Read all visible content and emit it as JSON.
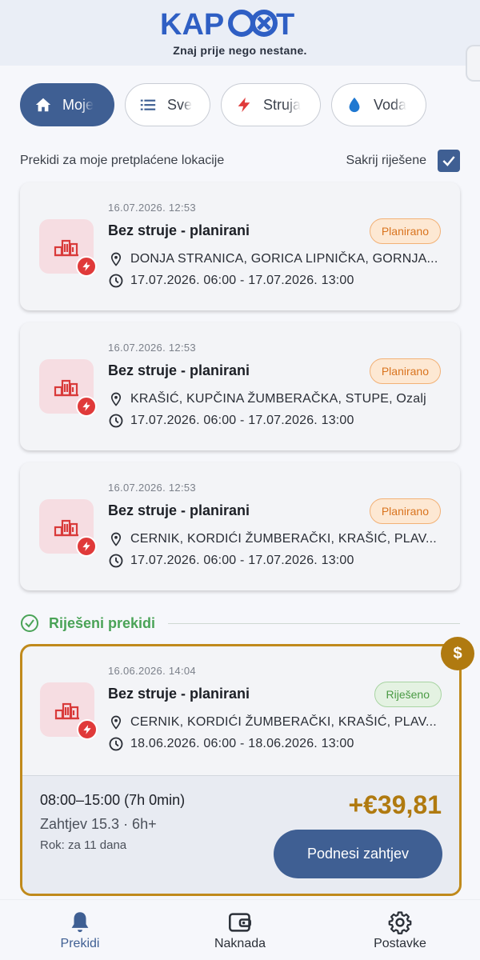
{
  "header": {
    "logo_text": "KAPOXT",
    "tagline": "Znaj prije nego nestane."
  },
  "filters": [
    {
      "label": "Moje",
      "icon": "home-icon",
      "active": true
    },
    {
      "label": "Sve",
      "icon": "list-icon",
      "active": false
    },
    {
      "label": "Struja",
      "icon": "lightning-icon",
      "active": false
    },
    {
      "label": "Voda",
      "icon": "water-drop-icon",
      "active": false
    }
  ],
  "subheader": {
    "text": "Prekidi za moje pretplaćene lokacije",
    "hide_resolved_label": "Sakrij riješene",
    "hide_resolved_checked": true
  },
  "outages": [
    {
      "date": "16.07.2026. 12:53",
      "title": "Bez struje - planirani",
      "status": "Planirano",
      "location": "DONJA STRANICA, GORICA LIPNIČKA, GORNJA...",
      "time": "17.07.2026. 06:00 - 17.07.2026. 13:00"
    },
    {
      "date": "16.07.2026. 12:53",
      "title": "Bez struje - planirani",
      "status": "Planirano",
      "location": "KRAŠIĆ, KUPČINA ŽUMBERAČKA, STUPE, Ozalj",
      "time": "17.07.2026. 06:00 - 17.07.2026. 13:00"
    },
    {
      "date": "16.07.2026. 12:53",
      "title": "Bez struje - planirani",
      "status": "Planirano",
      "location": "CERNIK, KORDIĆI ŽUMBERAČKI, KRAŠIĆ, PLAV...",
      "time": "17.07.2026. 06:00 - 17.07.2026. 13:00"
    }
  ],
  "resolved_section": {
    "title": "Riješeni prekidi"
  },
  "resolved_outage": {
    "date": "16.06.2026. 14:04",
    "title": "Bez struje - planirani",
    "status": "Riješeno",
    "location": "CERNIK, KORDIĆI ŽUMBERAČKI, KRAŠIĆ, PLAV...",
    "time": "18.06.2026. 06:00 - 18.06.2026. 13:00",
    "duration": "08:00–15:00 (7h 0min)",
    "claim": "Zahtjev 15.3 · 6h+",
    "deadline": "Rok: za 11 dana",
    "amount": "+€39,81",
    "submit_label": "Podnesi zahtjev",
    "compensation_symbol": "$"
  },
  "bottom_nav": [
    {
      "label": "Prekidi",
      "icon": "bell-icon",
      "active": true
    },
    {
      "label": "Naknada",
      "icon": "wallet-icon",
      "active": false
    },
    {
      "label": "Postavke",
      "icon": "gear-icon",
      "active": false
    }
  ],
  "colors": {
    "primary": "#3f5f93",
    "danger": "#e03a3a",
    "planned": "#d9741f",
    "resolved": "#4a9a44",
    "gold": "#b07a10"
  }
}
